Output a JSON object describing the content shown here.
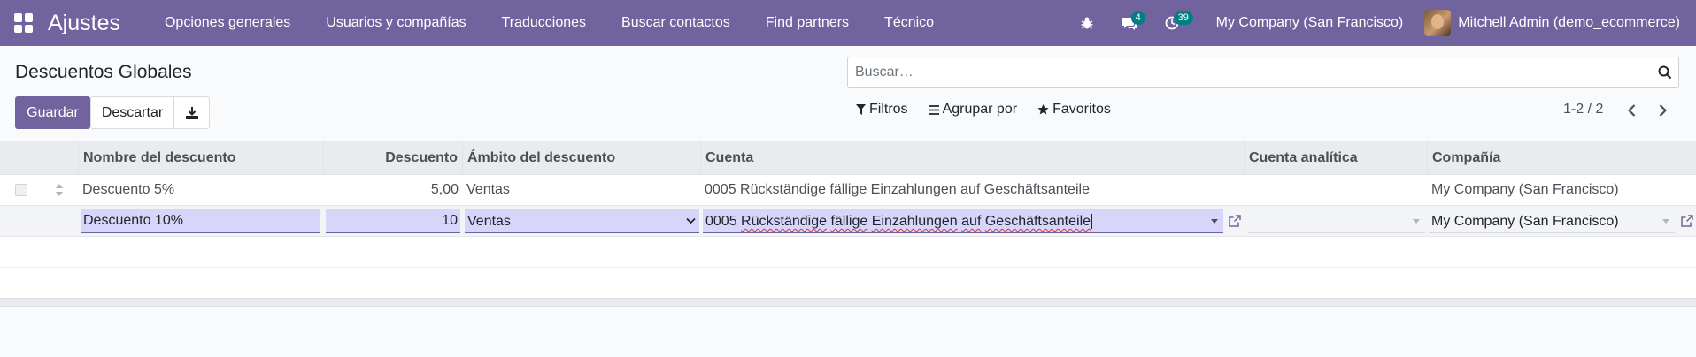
{
  "navbar": {
    "app_name": "Ajustes",
    "menu": [
      "Opciones generales",
      "Usuarios y compañías",
      "Traducciones",
      "Buscar contactos",
      "Find partners",
      "Técnico"
    ],
    "messages_badge": "4",
    "activities_badge": "39",
    "company": "My Company (San Francisco)",
    "user": "Mitchell Admin (demo_ecommerce)",
    "color": "#71639e"
  },
  "control": {
    "title": "Descuentos Globales",
    "search_placeholder": "Buscar…",
    "save_label": "Guardar",
    "discard_label": "Descartar",
    "filters_label": "Filtros",
    "groupby_label": "Agrupar por",
    "favorites_label": "Favoritos",
    "pager": "1-2 / 2"
  },
  "table": {
    "columns": [
      "Nombre del descuento",
      "Descuento",
      "Ámbito del descuento",
      "Cuenta",
      "Cuenta analítica",
      "Compañía"
    ],
    "rows": [
      {
        "name": "Descuento 5%",
        "discount": "5,00",
        "scope": "Ventas",
        "account": "0005 Rückständige fällige Einzahlungen auf Geschäftsanteile",
        "analytic": "",
        "company": "My Company (San Francisco)"
      }
    ],
    "edit_row": {
      "name": "Descuento 10%",
      "discount": "10",
      "scope": "Ventas",
      "account_code": "0005",
      "account_words": [
        "Rückständige",
        "fällige",
        "Einzahlungen",
        "auf",
        "Geschäftsanteile"
      ],
      "analytic": "",
      "company": "My Company (San Francisco)"
    }
  }
}
